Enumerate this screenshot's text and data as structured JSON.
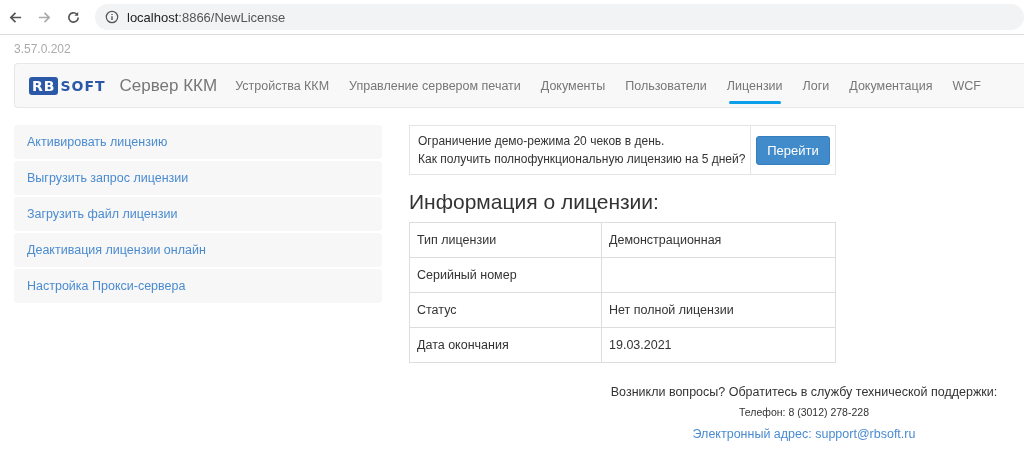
{
  "browser": {
    "url_host": "localhost",
    "url_path": ":8866/NewLicense"
  },
  "version": "3.57.0.202",
  "navbar": {
    "logo": {
      "box": "RB",
      "rest": "SOFT"
    },
    "brand": "Сервер ККМ",
    "items": [
      {
        "label": "Устройства ККМ",
        "selected": false
      },
      {
        "label": "Управление сервером печати",
        "selected": false
      },
      {
        "label": "Документы",
        "selected": false
      },
      {
        "label": "Пользователи",
        "selected": false
      },
      {
        "label": "Лицензии",
        "selected": true
      },
      {
        "label": "Логи",
        "selected": false
      },
      {
        "label": "Документация",
        "selected": false
      },
      {
        "label": "WCF",
        "selected": false
      }
    ]
  },
  "sidebar": {
    "items": [
      "Активировать лицензию",
      "Выгрузить запрос лицензии",
      "Загрузить файл лицензии",
      "Деактивация лицензии онлайн",
      "Настройка Прокси-сервера"
    ]
  },
  "notice": {
    "lines": [
      "Ограничение демо-режима 20 чеков в день.",
      "Как получить полнофункциональную лицензию на 5 дней?"
    ],
    "button": "Перейти"
  },
  "heading": "Информация о лицензии:",
  "table": {
    "rows": [
      [
        "Тип лицензии",
        "Демонстрационная"
      ],
      [
        "Серийный номер"
      ],
      [
        "Статус",
        "Нет полной лицензии"
      ],
      [
        "Дата окончания",
        "19.03.2021"
      ]
    ]
  },
  "footer": {
    "question": "Возникли вопросы? Обратитесь в службу технической поддержки:",
    "phone": "Телефон: 8 (3012) 278-228",
    "email": "Электронный адрес: support@rbsoft.ru"
  }
}
